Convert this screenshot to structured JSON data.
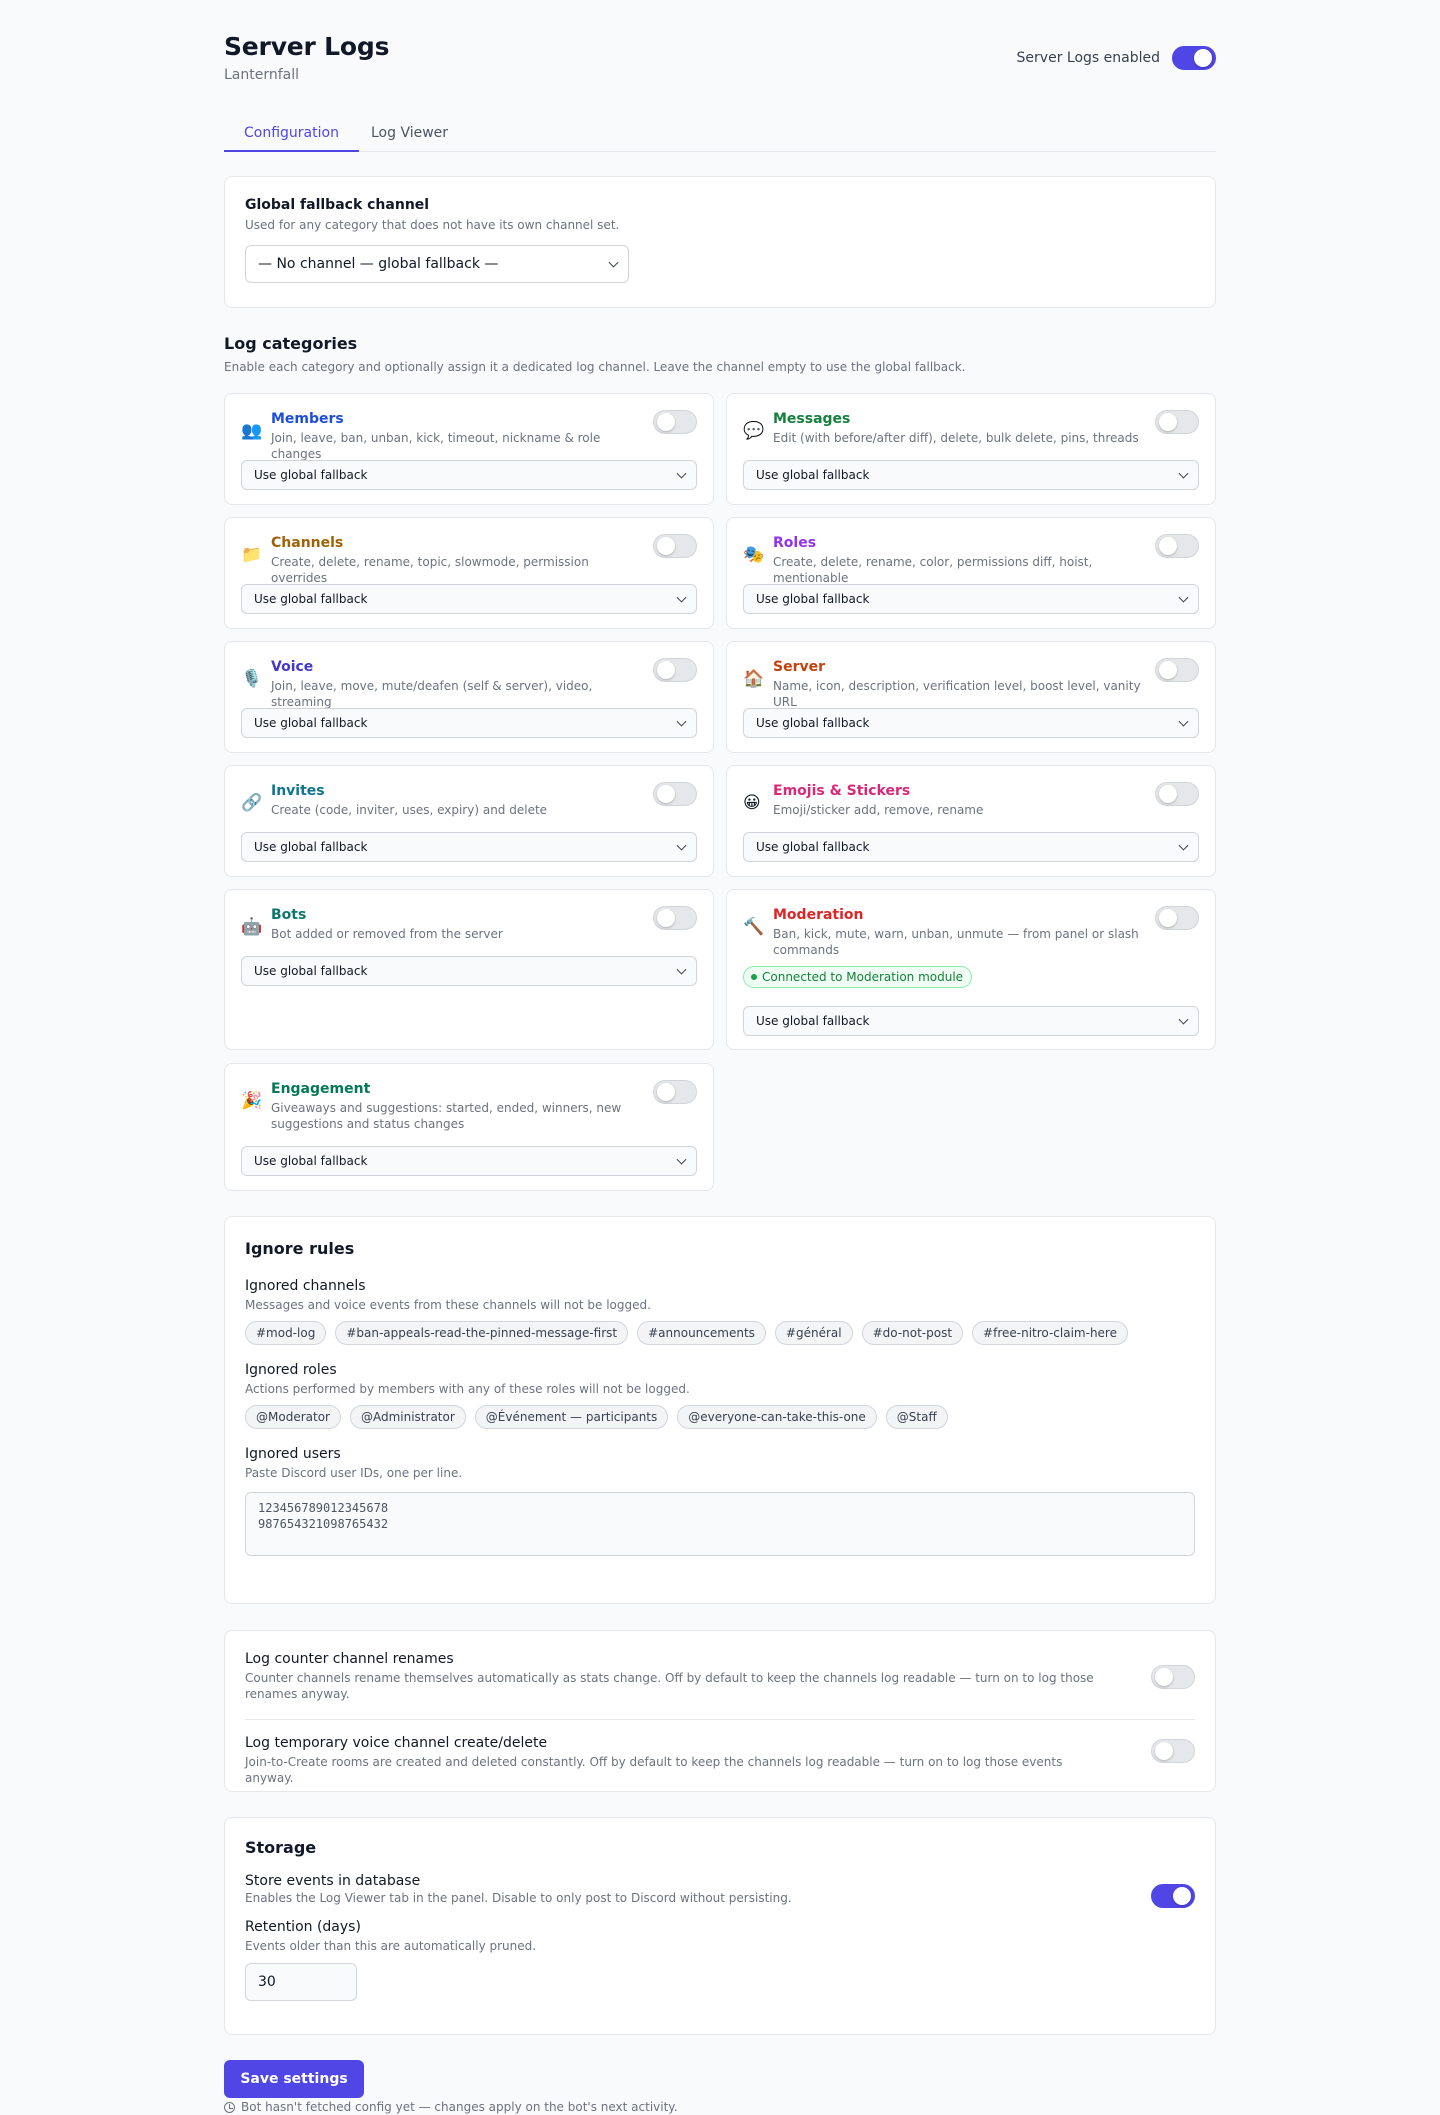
{
  "header": {
    "title": "Server Logs",
    "subtitle": "Lanternfall",
    "enabled_label": "Server Logs enabled",
    "enabled": true
  },
  "tabs": [
    {
      "label": "Configuration",
      "active": true
    },
    {
      "label": "Log Viewer",
      "active": false
    }
  ],
  "global_fallback": {
    "title": "Global fallback channel",
    "description": "Used for any category that does not have its own channel set.",
    "selected": "— No channel — global fallback —"
  },
  "log_categories": {
    "title": "Log categories",
    "description": "Enable each category and optionally assign it a dedicated log channel. Leave the channel empty to use the global fallback.",
    "items": [
      {
        "emoji": "👥",
        "name": "Members",
        "color": "#1d4ed8",
        "description": "Join, leave, ban, unban, kick, timeout, nickname & role changes",
        "channel": "Use global fallback",
        "enabled": false
      },
      {
        "emoji": "💬",
        "name": "Messages",
        "color": "#15803d",
        "description": "Edit (with before/after diff), delete, bulk delete, pins, threads",
        "channel": "Use global fallback",
        "enabled": false
      },
      {
        "emoji": "📁",
        "name": "Channels",
        "color": "#a16207",
        "description": "Create, delete, rename, topic, slowmode, permission overrides",
        "channel": "Use global fallback",
        "enabled": false
      },
      {
        "emoji": "🎭",
        "name": "Roles",
        "color": "#9333ea",
        "description": "Create, delete, rename, color, permissions diff, hoist, mentionable",
        "channel": "Use global fallback",
        "enabled": false
      },
      {
        "emoji": "🎙️",
        "name": "Voice",
        "color": "#4338ca",
        "description": "Join, leave, move, mute/deafen (self & server), video, streaming",
        "channel": "Use global fallback",
        "enabled": false
      },
      {
        "emoji": "🏠",
        "name": "Server",
        "color": "#c2410c",
        "description": "Name, icon, description, verification level, boost level, vanity URL",
        "channel": "Use global fallback",
        "enabled": false
      },
      {
        "emoji": "🔗",
        "name": "Invites",
        "color": "#0e7490",
        "description": "Create (code, inviter, uses, expiry) and delete",
        "channel": "Use global fallback",
        "enabled": false
      },
      {
        "emoji": "😀",
        "name": "Emojis & Stickers",
        "color": "#db2777",
        "description": "Emoji/sticker add, remove, rename",
        "channel": "Use global fallback",
        "enabled": false
      },
      {
        "emoji": "🤖",
        "name": "Bots",
        "color": "#0f766e",
        "description": "Bot added or removed from the server",
        "channel": "Use global fallback",
        "enabled": false
      },
      {
        "emoji": "🔨",
        "name": "Moderation",
        "color": "#dc2626",
        "description": "Ban, kick, mute, warn, unban, unmute — from panel or slash commands",
        "badge": "Connected to Moderation module",
        "channel": "Use global fallback",
        "enabled": false
      },
      {
        "emoji": "🎉",
        "name": "Engagement",
        "color": "#047857",
        "description": "Giveaways and suggestions: started, ended, winners, new suggestions and status changes",
        "channel": "Use global fallback",
        "enabled": false
      }
    ]
  },
  "ignore_rules": {
    "title": "Ignore rules",
    "channels": {
      "title": "Ignored channels",
      "description": "Messages and voice events from these channels will not be logged.",
      "items": [
        "#mod-log",
        "#ban-appeals-read-the-pinned-message-first",
        "#announcements",
        "#général",
        "#do-not-post",
        "#free-nitro-claim-here"
      ]
    },
    "roles": {
      "title": "Ignored roles",
      "description": "Actions performed by members with any of these roles will not be logged.",
      "items": [
        "@Moderator",
        "@Administrator",
        "@Événement — participants",
        "@everyone-can-take-this-one",
        "@Staff"
      ]
    },
    "users": {
      "title": "Ignored users",
      "description": "Paste Discord user IDs, one per line.",
      "lines": [
        "123456789012345678",
        "987654321098765432"
      ]
    }
  },
  "misc": {
    "counter": {
      "title": "Log counter channel renames",
      "description": "Counter channels rename themselves automatically as stats change. Off by default to keep the channels log readable — turn on to log those renames anyway.",
      "enabled": false
    },
    "temp_voice": {
      "title": "Log temporary voice channel create/delete",
      "description": "Join-to-Create rooms are created and deleted constantly. Off by default to keep the channels log readable — turn on to log those events anyway.",
      "enabled": false
    }
  },
  "storage": {
    "title": "Storage",
    "store_title": "Store events in database",
    "store_description": "Enables the Log Viewer tab in the panel. Disable to only post to Discord without persisting.",
    "store_enabled": true,
    "retention_title": "Retention (days)",
    "retention_description": "Events older than this are automatically pruned.",
    "retention_value": "30"
  },
  "footer": {
    "save_label": "Save settings",
    "note": "Bot hasn't fetched config yet — changes apply on the bot's next activity."
  },
  "colors": {
    "accent": "#4f46e5",
    "success": "#16a34a"
  }
}
